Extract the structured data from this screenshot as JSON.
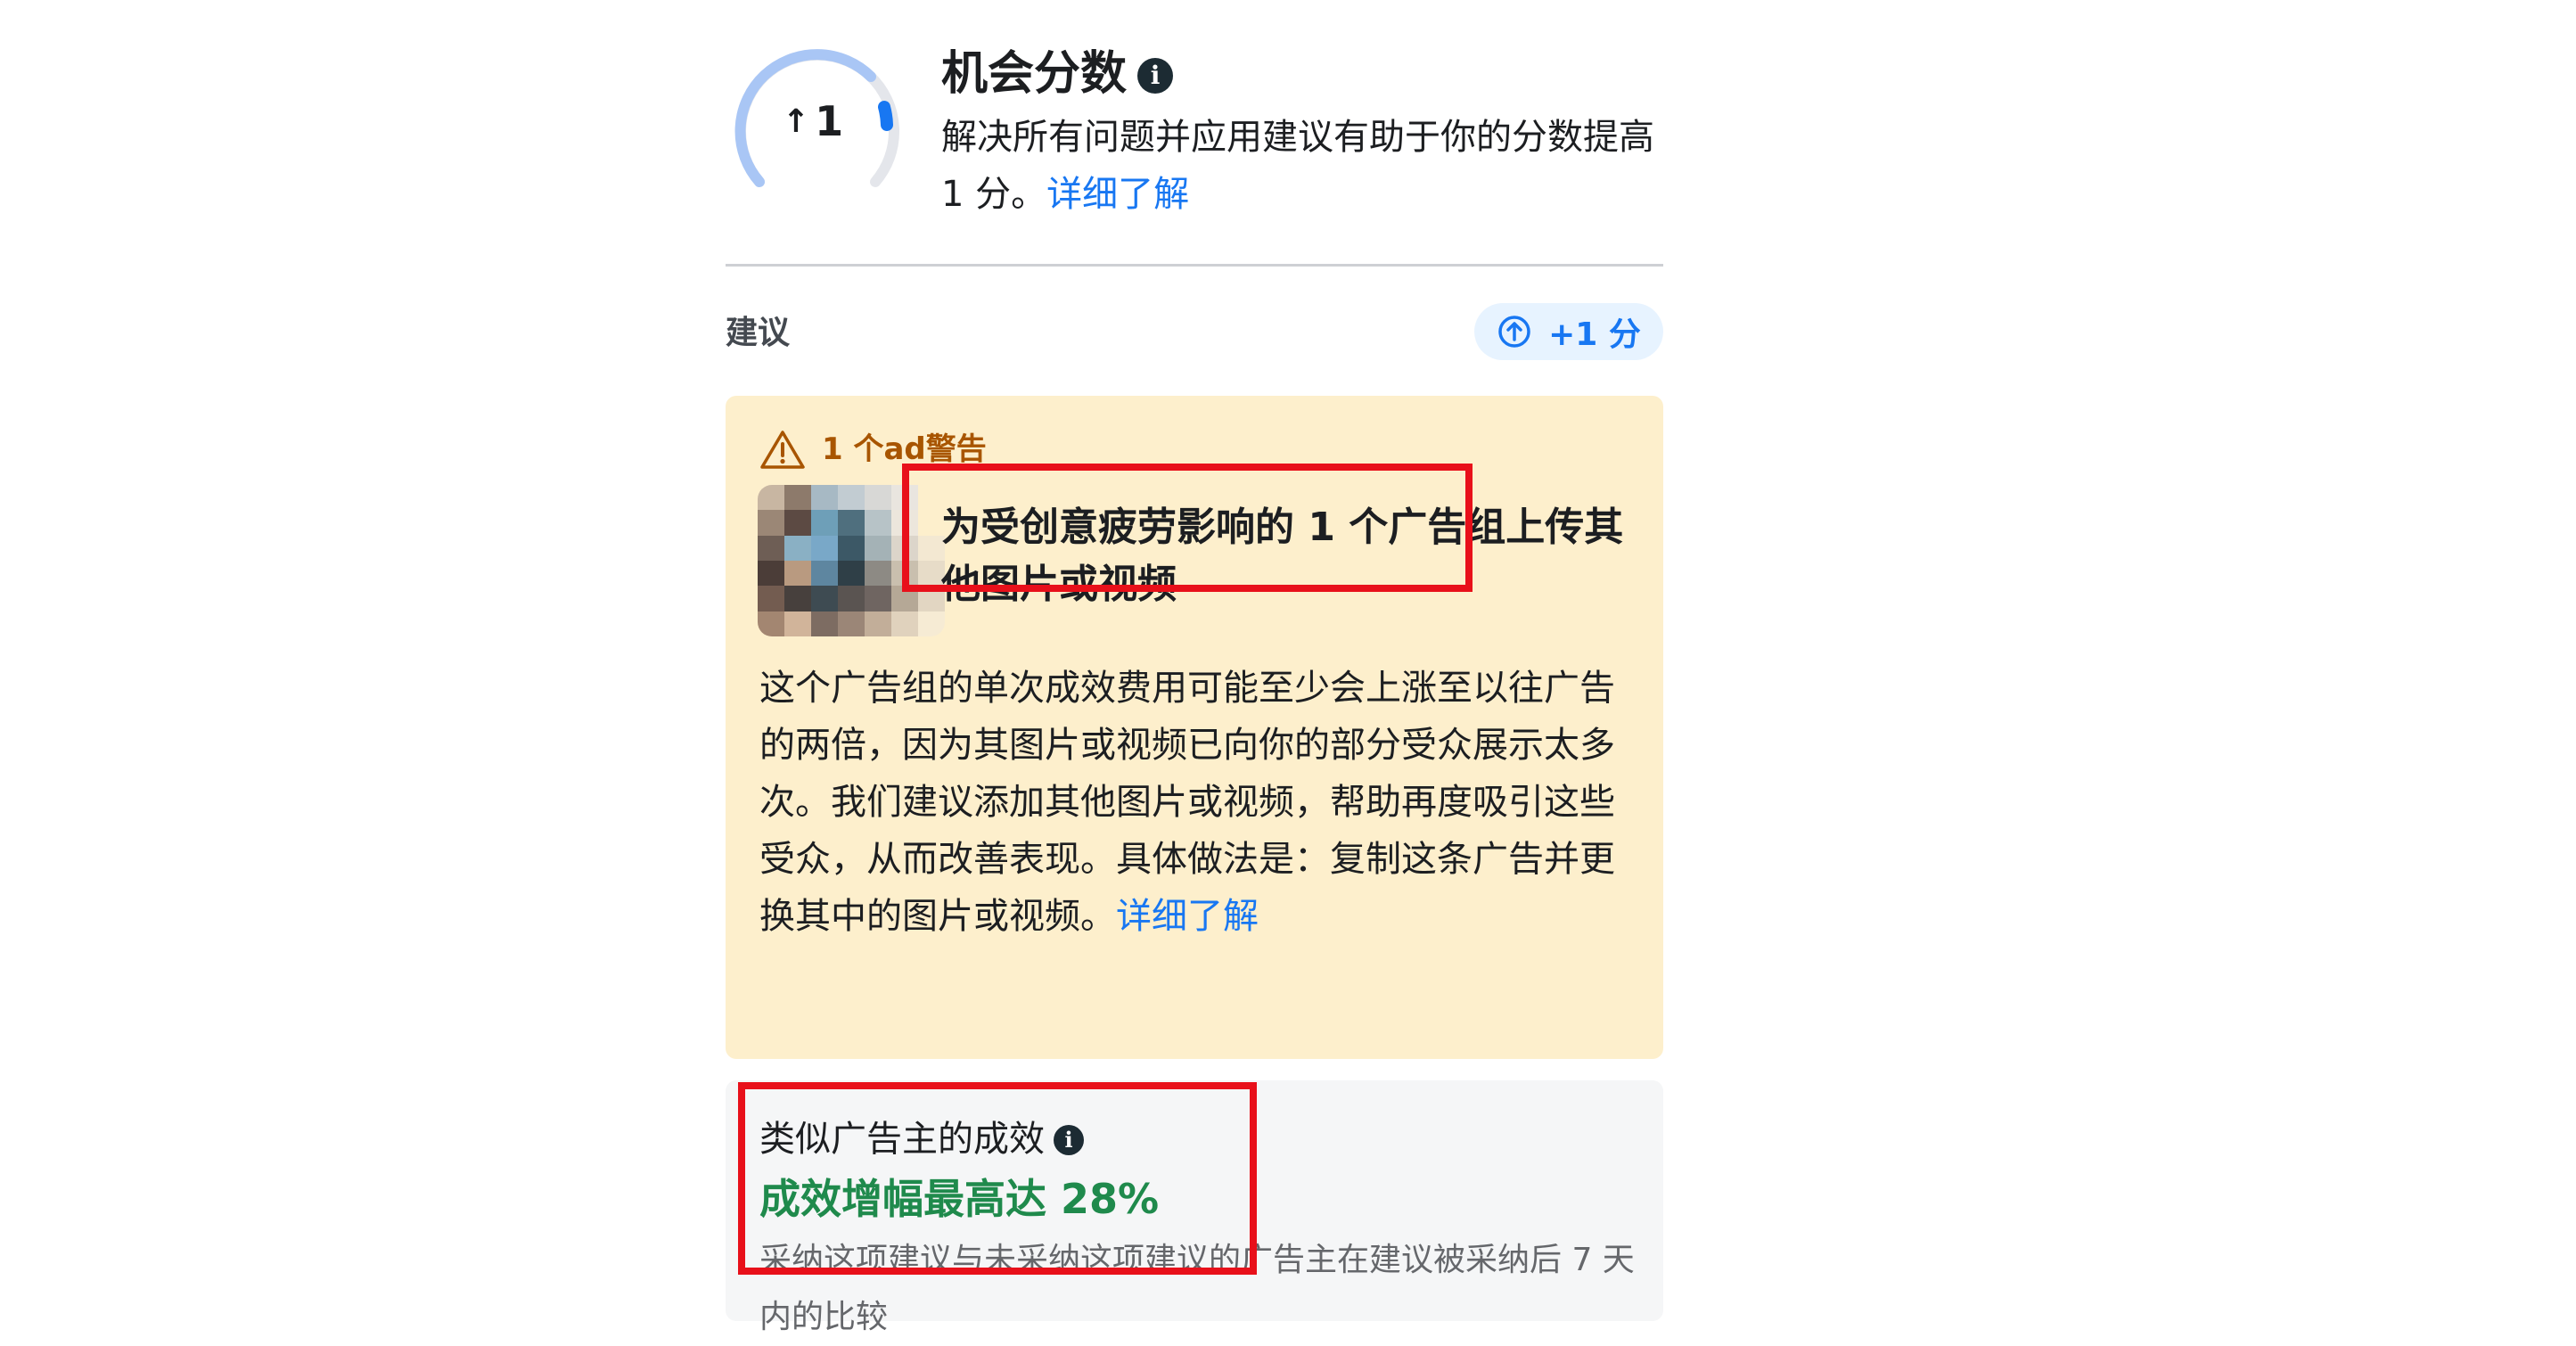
{
  "header": {
    "gauge_value": "1",
    "title": "机会分数",
    "description": "解决所有问题并应用建议有助于你的分数提高 1 分。",
    "learn_more": "详细了解"
  },
  "suggestions": {
    "label": "建议",
    "points_badge": "+1 分"
  },
  "warning_card": {
    "header": "1 个ad警告",
    "title": "为受创意疲劳影响的 1 个广告组上传其他图片或视频",
    "body": "这个广告组的单次成效费用可能至少会上涨至以往广告的两倍，因为其图片或视频已向你的部分受众展示太多次。我们建议添加其他图片或视频，帮助再度吸引这些受众，从而改善表现。具体做法是：复制这条广告并更换其中的图片或视频。",
    "learn_more": "详细了解"
  },
  "results_card": {
    "label": "类似广告主的成效",
    "value": "成效增幅最高达 28%",
    "note": "采纳这项建议与未采纳这项建议的广告主在建议被采纳后 7 天内的比较"
  },
  "colors": {
    "accent_blue": "#1877f2",
    "warning_bg": "#fdefcc",
    "warning_text": "#a85500",
    "success_green": "#1f8a4c",
    "annotation_red": "#e8101a"
  }
}
